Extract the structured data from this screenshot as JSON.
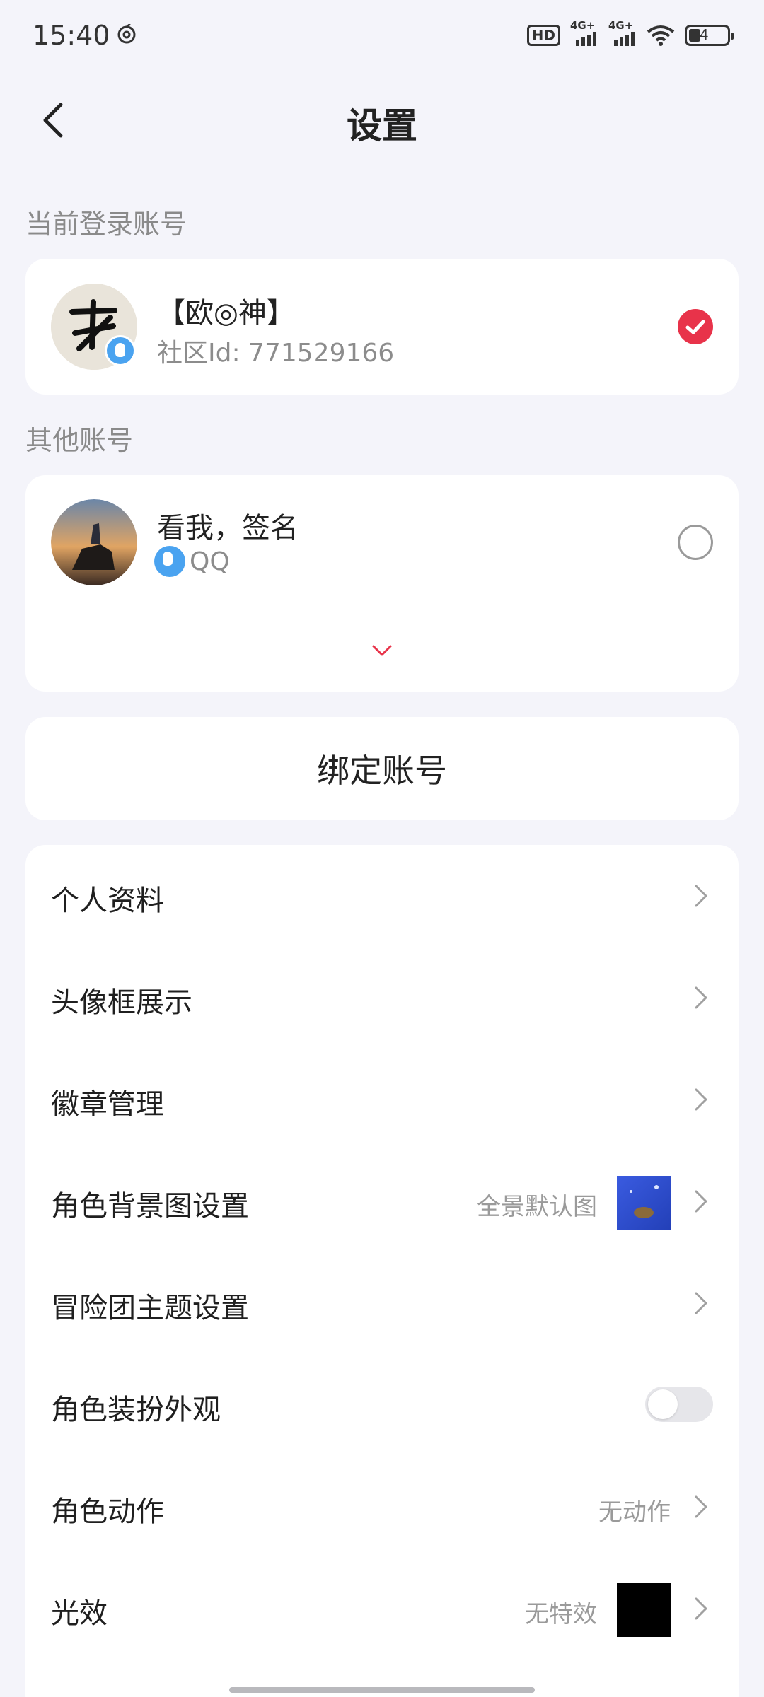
{
  "status_bar": {
    "time": "15:40",
    "hd_label": "HD",
    "signal1_label": "4G+",
    "signal2_label": "4G+",
    "battery_level": "4"
  },
  "header": {
    "title": "设置"
  },
  "current_account": {
    "section_label": "当前登录账号",
    "name": "【欧◎神】",
    "community_id": "社区Id: 771529166",
    "selected": true
  },
  "other_accounts": {
    "section_label": "其他账号",
    "items": [
      {
        "name": "看我，签名",
        "platform": "QQ",
        "selected": false
      }
    ]
  },
  "bind_account": {
    "label": "绑定账号"
  },
  "menu": {
    "items": [
      {
        "label": "个人资料"
      },
      {
        "label": "头像框展示"
      },
      {
        "label": "徽章管理"
      },
      {
        "label": "角色背景图设置",
        "value": "全景默认图"
      },
      {
        "label": "冒险团主题设置"
      },
      {
        "label": "角色装扮外观",
        "toggle_on": false
      },
      {
        "label": "角色动作",
        "value": "无动作"
      },
      {
        "label": "光效",
        "value": "无特效"
      }
    ]
  },
  "colors": {
    "accent_red": "#e8334a",
    "qq_blue": "#4aa3f0",
    "background": "#f4f4fa"
  }
}
